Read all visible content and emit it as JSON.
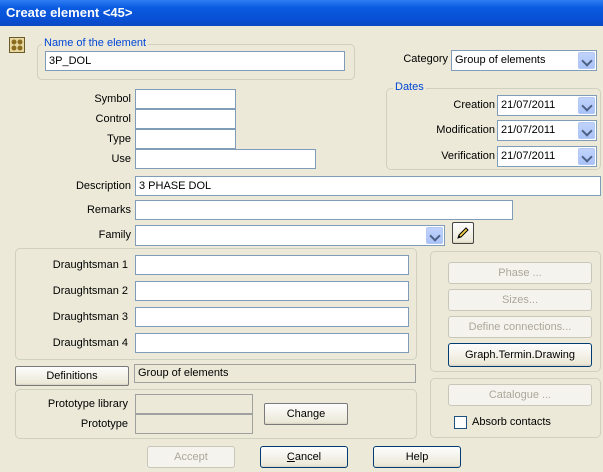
{
  "window": {
    "title": "Create element <45>"
  },
  "name_group": {
    "legend": "Name of the element",
    "value": "3P_DOL"
  },
  "category": {
    "label": "Category",
    "value": "Group of elements"
  },
  "dates": {
    "legend": "Dates",
    "creation_label": "Creation",
    "creation_value": "21/07/2011",
    "modification_label": "Modification",
    "modification_value": "21/07/2011",
    "verification_label": "Verification",
    "verification_value": "21/07/2011"
  },
  "fields": {
    "symbol_label": "Symbol",
    "symbol_value": "",
    "control_label": "Control",
    "control_value": "",
    "type_label": "Type",
    "type_value": "",
    "use_label": "Use",
    "use_value": "",
    "description_label": "Description",
    "description_value": "3 PHASE DOL",
    "remarks_label": "Remarks",
    "remarks_value": "",
    "family_label": "Family",
    "family_value": ""
  },
  "draughtsmen": [
    {
      "label": "Draughtsman 1",
      "value": ""
    },
    {
      "label": "Draughtsman 2",
      "value": ""
    },
    {
      "label": "Draughtsman 3",
      "value": ""
    },
    {
      "label": "Draughtsman 4",
      "value": ""
    }
  ],
  "right_buttons": {
    "phase": "Phase ...",
    "sizes": "Sizes...",
    "define_connections": "Define connections...",
    "graph_termin": "Graph.Termin.Drawing",
    "catalogue": "Catalogue ..."
  },
  "definitions": {
    "button": "Definitions",
    "value": "Group of elements"
  },
  "prototype": {
    "library_label": "Prototype library",
    "library_value": "",
    "prototype_label": "Prototype",
    "prototype_value": "",
    "change_button": "Change"
  },
  "absorb_contacts": {
    "label": "Absorb contacts",
    "checked": false
  },
  "bottom_buttons": {
    "accept": "Accept",
    "cancel_first": "C",
    "cancel_rest": "ancel",
    "help": "Help"
  },
  "icons": {
    "app": "element-app-icon",
    "pencil": "pencil-icon"
  }
}
